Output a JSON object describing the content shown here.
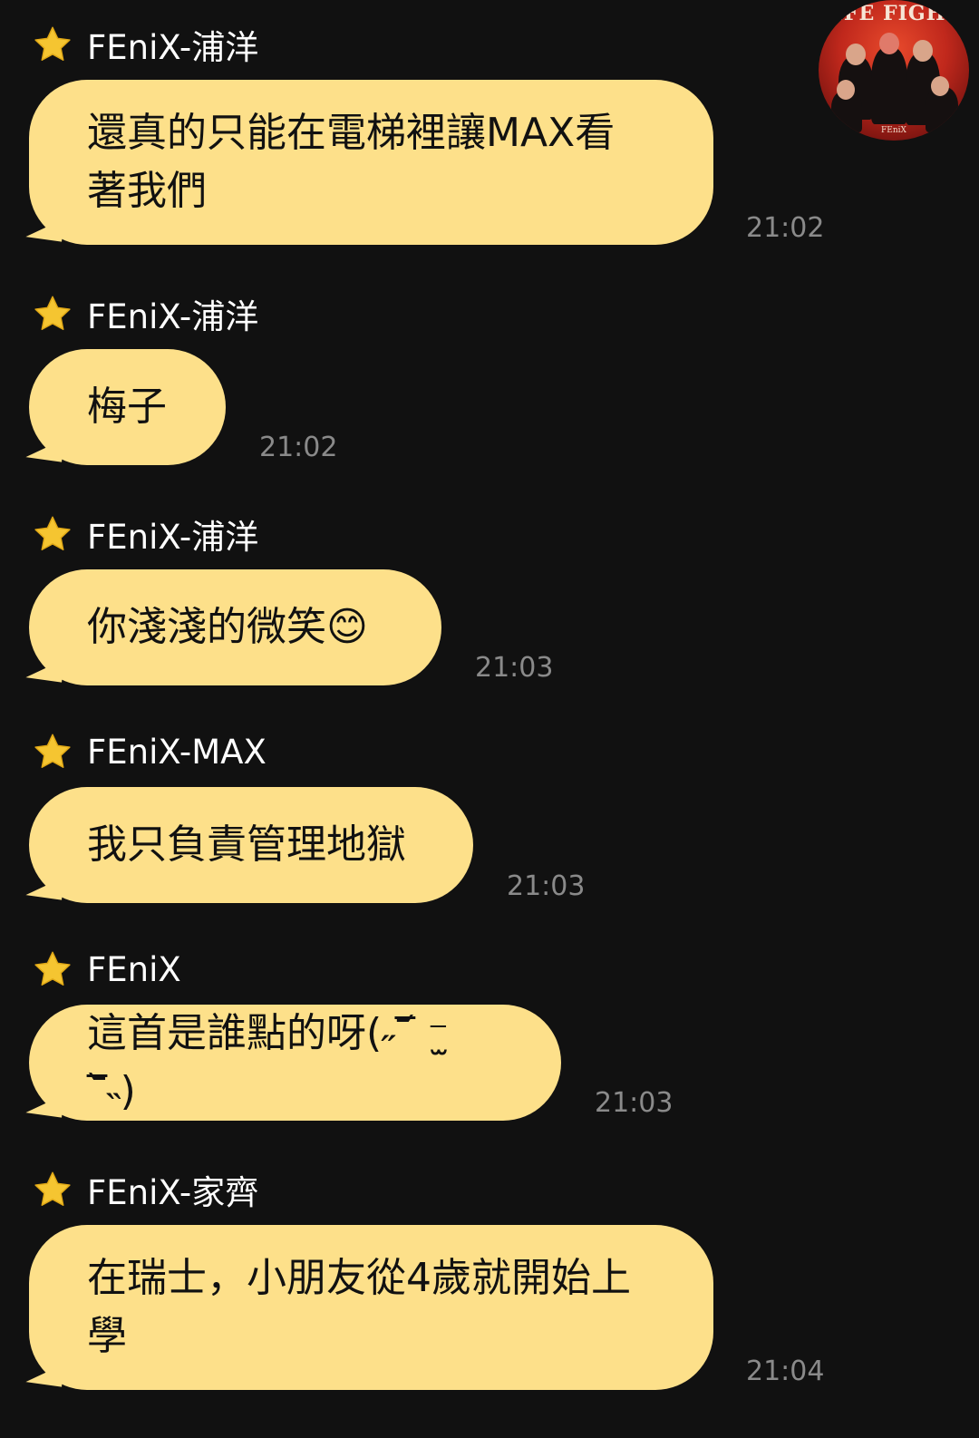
{
  "chat": {
    "group_avatar_title": "FIFE FIGHTER",
    "group_avatar_logo": "FEniX",
    "messages": [
      {
        "sender": "FEniX-浦洋",
        "text": "還真的只能在電梯裡讓MAX看著我們",
        "time": "21:02"
      },
      {
        "sender": "FEniX-浦洋",
        "text": "梅子",
        "time": "21:02"
      },
      {
        "sender": "FEniX-浦洋",
        "text": "你淺淺的微笑😊",
        "time": "21:03"
      },
      {
        "sender": "FEniX-MAX",
        "text": "我只負責管理地獄",
        "time": "21:03"
      },
      {
        "sender": "FEniX",
        "text": "這首是誰點的呀(˶‾᷄ ⁻̫ ‾᷅˵)",
        "time": "21:03"
      },
      {
        "sender": "FEniX-家齊",
        "text": "在瑞士，小朋友從4歲就開始上學",
        "time": "21:04"
      }
    ]
  },
  "colors": {
    "background": "#111111",
    "bubble": "#fde08a",
    "star": "#f5c531",
    "timestamp": "#8a8a8a"
  },
  "icons": {
    "sender_badge": "star-icon"
  }
}
